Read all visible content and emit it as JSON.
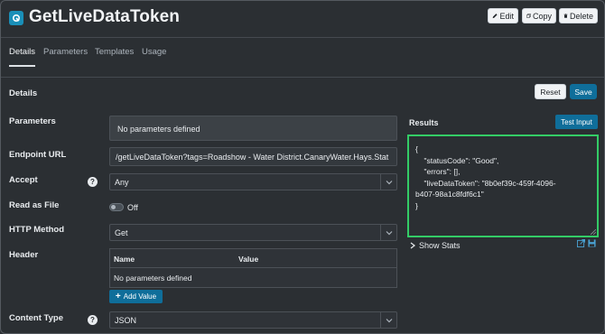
{
  "header": {
    "title": "GetLiveDataToken",
    "edit_label": "Edit",
    "copy_label": "Copy",
    "delete_label": "Delete"
  },
  "tabs": [
    {
      "label": "Details",
      "active": true
    },
    {
      "label": "Parameters",
      "active": false
    },
    {
      "label": "Templates",
      "active": false
    },
    {
      "label": "Usage",
      "active": false
    }
  ],
  "details": {
    "section_title": "Details",
    "reset_label": "Reset",
    "save_label": "Save",
    "parameters_label": "Parameters",
    "parameters_value": "No parameters defined",
    "endpoint_label": "Endpoint URL",
    "endpoint_value": "/getLiveDataToken?tags=Roadshow - Water District.CanaryWater.Hays.Stat",
    "accept_label": "Accept",
    "accept_value": "Any",
    "read_as_file_label": "Read as File",
    "read_as_file_value": "Off",
    "http_method_label": "HTTP Method",
    "http_method_value": "Get",
    "header_label": "Header",
    "header_columns": [
      "Name",
      "Value"
    ],
    "header_empty": "No parameters defined",
    "add_value_label": "Add Value",
    "content_type_label": "Content Type",
    "content_type_value": "JSON",
    "help_glyph": "?"
  },
  "results": {
    "title": "Results",
    "test_input_label": "Test Input",
    "json_lines": [
      "{",
      "    \"statusCode\": \"Good\",",
      "    \"errors\": [],",
      "    \"liveDataToken\": \"8b0ef39c-459f-4096-",
      "b407-98a1c8fdf6c1\"",
      "}"
    ],
    "show_stats_label": "Show Stats"
  },
  "colors": {
    "accent": "#0f6e9a",
    "results_border": "#33cc66",
    "background": "#2b2f33"
  }
}
